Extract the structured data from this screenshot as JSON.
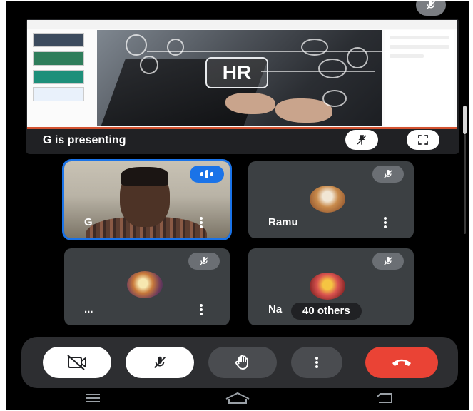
{
  "presentation": {
    "presenting_label": "G is presenting",
    "slide_text": "HR"
  },
  "participants": [
    {
      "name": "G",
      "speaking": true
    },
    {
      "name": "Ramu",
      "muted": true
    },
    {
      "name": "...",
      "muted": true
    },
    {
      "name": "Na",
      "muted": true,
      "others_label": "40 others"
    }
  ],
  "controls": [
    "camera-off",
    "mic-off",
    "raise-hand",
    "more-options",
    "end-call"
  ],
  "colors": {
    "background": "#000000",
    "tile": "#3c4043",
    "speaking_accent": "#1a73e8",
    "end_call": "#ea4335",
    "slide_accent": "#d35230"
  },
  "icons": {
    "muted": "mic-off-icon",
    "speaking": "audio-wave-icon",
    "pin": "pin-off-icon",
    "fullscreen": "fullscreen-icon",
    "camera": "camera-off-icon",
    "hand": "raise-hand-icon",
    "hangup": "hang-up-icon"
  }
}
